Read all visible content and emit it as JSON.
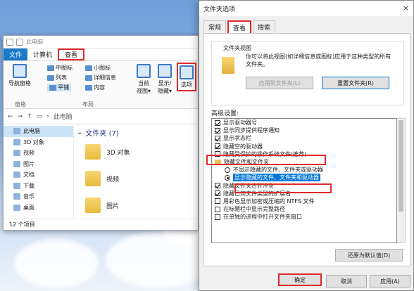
{
  "explorer": {
    "title": "此电脑",
    "tabs": [
      "文件",
      "计算机",
      "查看"
    ],
    "ribbon": {
      "nav_pane": "导航窗格",
      "layout_items": [
        "中图标",
        "小图标",
        "列表",
        "详细信息",
        "平铺",
        "内容"
      ],
      "current_view": "当前\n视图▾",
      "show_hide": "显示/\n隐藏▾",
      "options": "选项",
      "group_pane": "窗格",
      "group_layout": "布局"
    },
    "address": {
      "path": "此电脑"
    },
    "nav": [
      "此电脑",
      "3D 对象",
      "视频",
      "图片",
      "文档",
      "下载",
      "音乐",
      "桌面"
    ],
    "content": {
      "section": "文件夹 (7)",
      "folders": [
        "3D 对象",
        "视频",
        "图片"
      ]
    },
    "status": "12 个项目"
  },
  "dialog": {
    "title": "文件夹选项",
    "close": "×",
    "tabs": [
      "常规",
      "查看",
      "搜索"
    ],
    "folder_views": {
      "legend": "文件夹视图",
      "desc": "你可以将此视图(如详细信息或图标)应用于这种类型的所有文件夹。",
      "apply_btn": "应用到文件夹(L)",
      "reset_btn": "重置文件夹(R)"
    },
    "advanced_label": "高级设置:",
    "tree": [
      {
        "type": "checkbox",
        "checked": true,
        "label": "显示驱动器号",
        "indent": 0
      },
      {
        "type": "checkbox",
        "checked": true,
        "label": "显示同步提供程序通知",
        "indent": 0
      },
      {
        "type": "checkbox",
        "checked": true,
        "label": "显示状态栏",
        "indent": 0
      },
      {
        "type": "checkbox",
        "checked": true,
        "label": "隐藏空的驱动器",
        "indent": 0
      },
      {
        "type": "checkbox",
        "checked": false,
        "label": "隐藏受保护的操作系统文件(推荐)",
        "indent": 0
      },
      {
        "type": "folder",
        "checked": false,
        "label": "隐藏文件和文件夹",
        "indent": 0
      },
      {
        "type": "radio",
        "checked": false,
        "label": "不显示隐藏的文件、文件夹或驱动器",
        "indent": 1
      },
      {
        "type": "radio",
        "checked": true,
        "label": "显示隐藏的文件、文件夹和驱动器",
        "indent": 1
      },
      {
        "type": "checkbox",
        "checked": true,
        "label": "隐藏文件夹合并冲突",
        "indent": 0
      },
      {
        "type": "checkbox",
        "checked": true,
        "label": "隐藏已知文件类型的扩展名",
        "indent": 0
      },
      {
        "type": "checkbox",
        "checked": false,
        "label": "用彩色显示加密或压缩的 NTFS 文件",
        "indent": 0
      },
      {
        "type": "checkbox",
        "checked": false,
        "label": "在标题栏中显示完整路径",
        "indent": 0
      },
      {
        "type": "checkbox",
        "checked": false,
        "label": "在单独的进程中打开文件夹窗口",
        "indent": 0
      }
    ],
    "restore_btn": "还原为默认值(D)",
    "ok_btn": "确定",
    "cancel_btn": "取消",
    "apply_btn": "应用(A)"
  }
}
